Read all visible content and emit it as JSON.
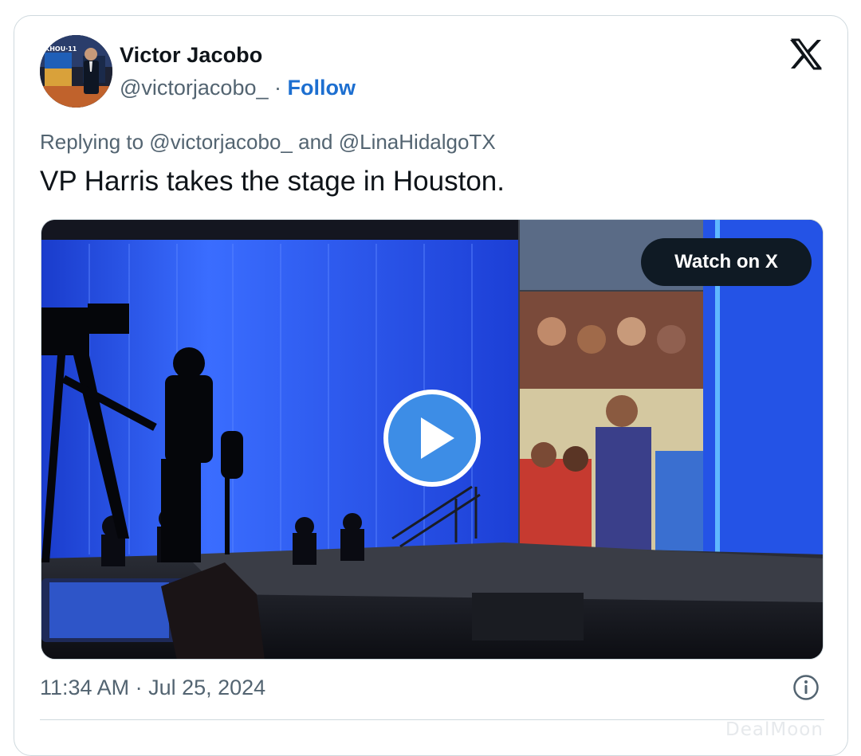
{
  "author": {
    "name": "Victor Jacobo",
    "handle": "@victorjacobo_",
    "separator": " · ",
    "follow_label": "Follow",
    "avatar_text": "KHOU·11"
  },
  "reply": {
    "text": "Replying to @victorjacobo_ and @LinaHidalgoTX"
  },
  "tweet": {
    "text": "VP Harris takes the stage in Houston."
  },
  "media": {
    "watch_label": "Watch on X"
  },
  "timestamp": "11:34 AM · Jul 25, 2024",
  "watermark": "DealMoon",
  "colors": {
    "follow": "#1d6fd0",
    "secondary_text": "#536471",
    "stage_blue": "#1f4fe0",
    "play_blue": "#3d8de6"
  },
  "icons": {
    "brand": "x-logo-icon",
    "play": "play-icon",
    "info": "info-icon"
  }
}
